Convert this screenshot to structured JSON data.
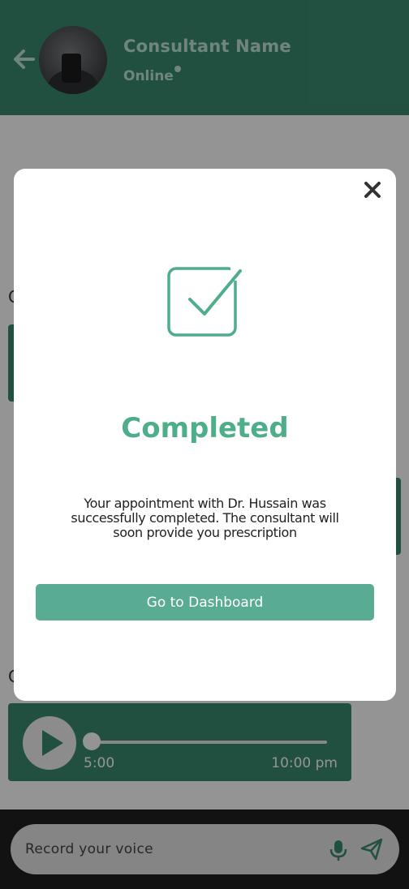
{
  "header": {
    "consultant_name": "Consultant Name",
    "status": "Online",
    "back_icon": "arrow-left-icon",
    "avatar": "consultant-avatar"
  },
  "chat": {
    "audio_message": {
      "duration": "5:00",
      "time": "10:00 pm",
      "progress": 0,
      "play_icon": "play-icon"
    },
    "record_placeholder": "Record your voice",
    "mic_icon": "microphone-icon",
    "send_icon": "send-icon"
  },
  "modal": {
    "close_icon": "close-icon",
    "status_icon": "checkbox-checked-icon",
    "title": "Completed",
    "message": "Your appointment with Dr. Hussain was successfully completed. The consultant will soon provide you prescription",
    "button_label": "Go to Dashboard"
  },
  "colors": {
    "primary": "#3a8a70",
    "accent": "#4fae8a",
    "button": "#5aab93",
    "overlay": "rgba(0,0,0,0.42)"
  }
}
